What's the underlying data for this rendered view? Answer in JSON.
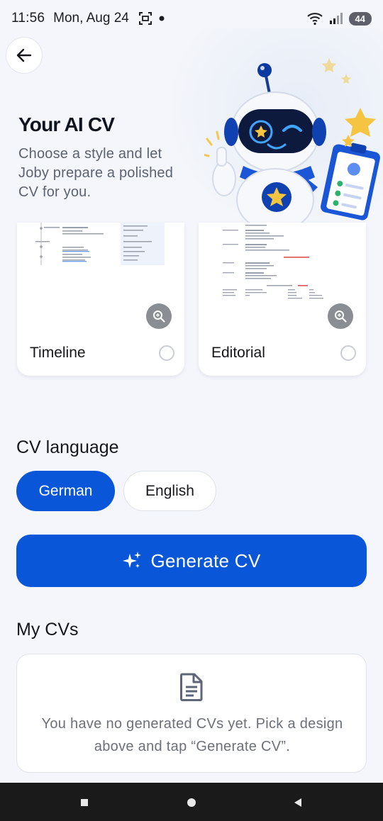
{
  "status_bar": {
    "time": "11:56",
    "date": "Mon, Aug 24",
    "battery": "44"
  },
  "header": {
    "title": "Your AI CV",
    "subtitle": "Choose a style and let Joby prepare a polished CV for you."
  },
  "templates": [
    {
      "label": "Timeline",
      "selected": false
    },
    {
      "label": "Editorial",
      "selected": false
    }
  ],
  "language": {
    "title": "CV language",
    "options": [
      {
        "label": "German",
        "active": true
      },
      {
        "label": "English",
        "active": false
      }
    ]
  },
  "generate_button": {
    "label": "Generate CV"
  },
  "my_cvs": {
    "title": "My CVs",
    "empty_message": "You have no generated CVs yet. Pick a design above and tap “Generate CV”."
  },
  "colors": {
    "accent": "#0a56d9",
    "background": "#f4f6fb",
    "nav_bar": "#1a1a1b"
  },
  "icons": {
    "back": "arrow-left-icon",
    "zoom": "zoom-in-icon",
    "sparkle": "sparkles-icon",
    "document": "document-icon"
  }
}
